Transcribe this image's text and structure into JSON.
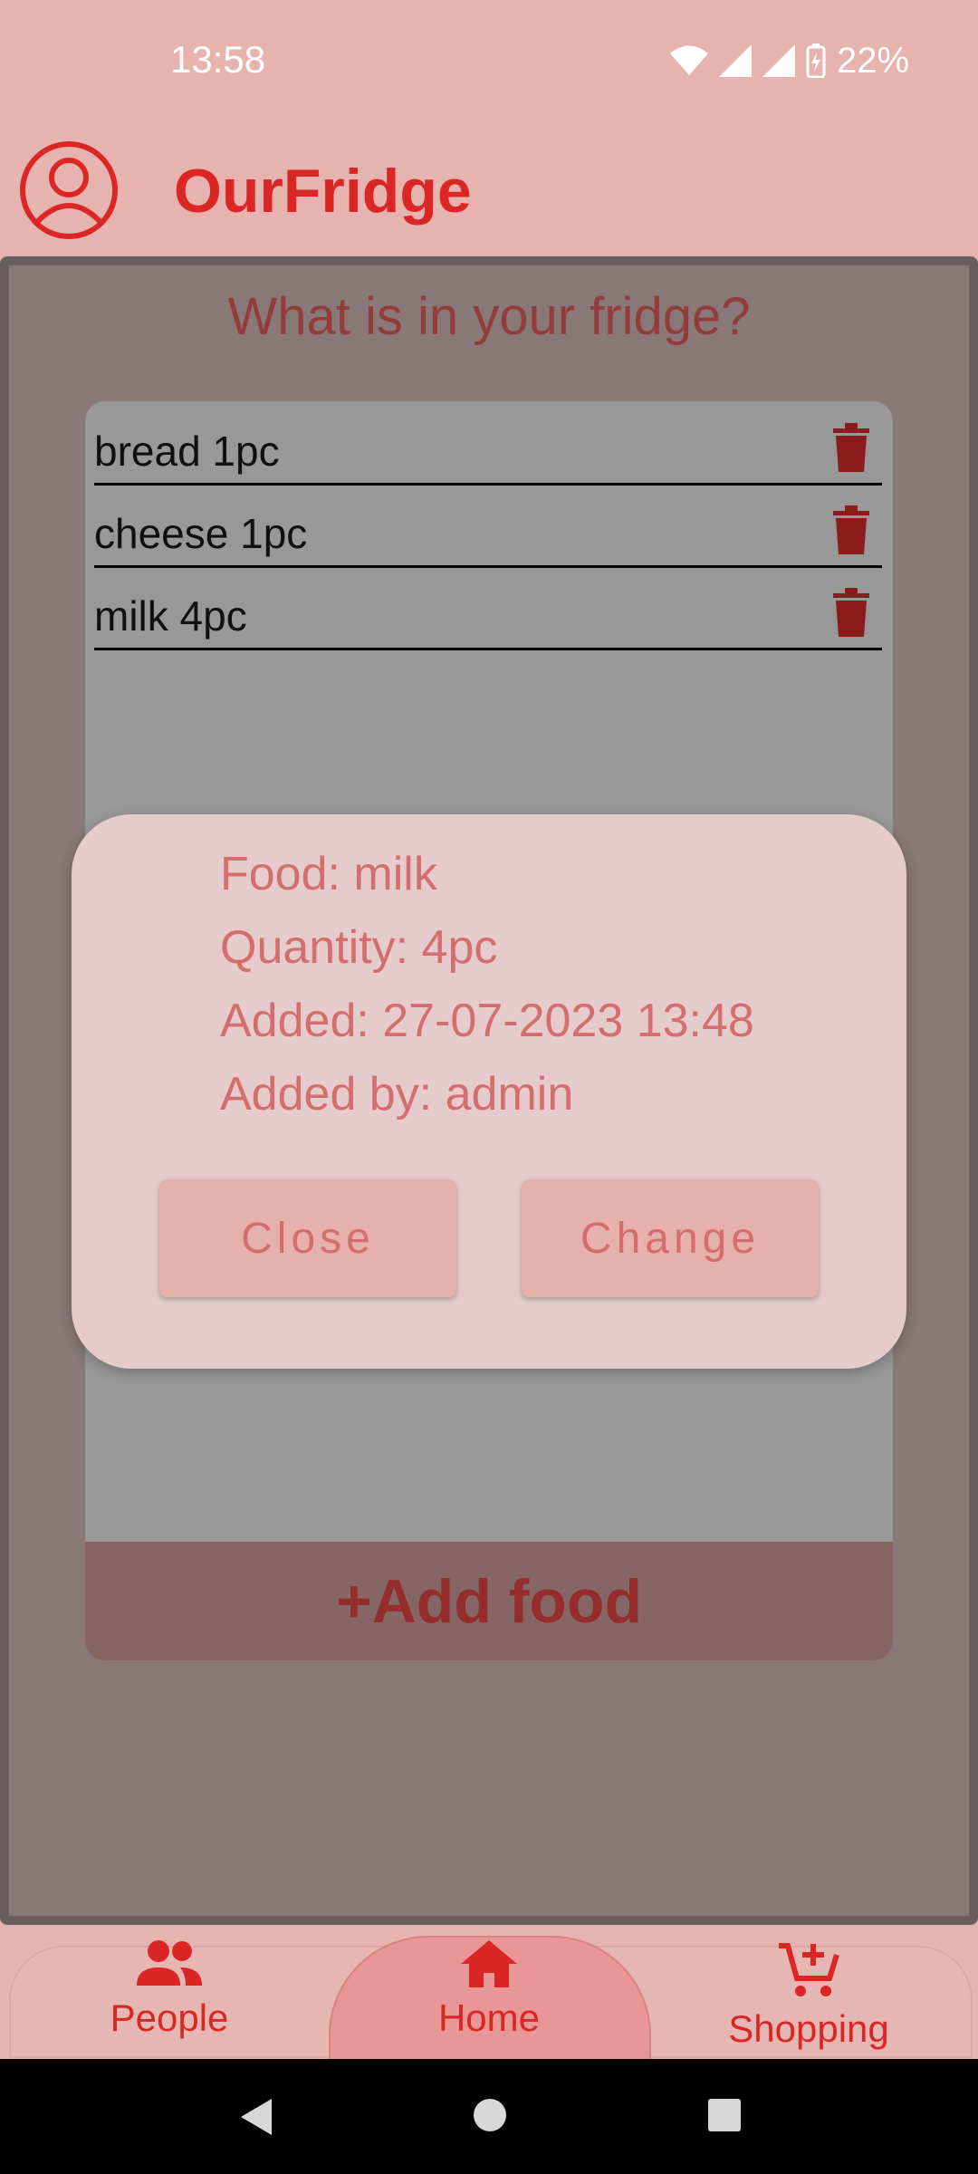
{
  "status_bar": {
    "time": "13:58",
    "battery": "22%"
  },
  "header": {
    "title": "OurFridge"
  },
  "main": {
    "heading": "What is in your fridge?",
    "items": [
      {
        "label": "bread 1pc"
      },
      {
        "label": "cheese 1pc"
      },
      {
        "label": "milk 4pc"
      }
    ],
    "add_button": "+Add food"
  },
  "dialog": {
    "food": "Food: milk",
    "quantity": "Quantity: 4pc",
    "added": "Added: 27-07-2023 13:48",
    "added_by": "Added by: admin",
    "close_label": "Close",
    "change_label": "Change"
  },
  "bottom_nav": {
    "items": [
      {
        "label": "People",
        "icon": "people-icon"
      },
      {
        "label": "Home",
        "icon": "home-icon",
        "active": true
      },
      {
        "label": "Shopping",
        "icon": "add-shopping-cart-icon"
      }
    ]
  },
  "colors": {
    "accent": "#db2626",
    "dialog_bg": "#e6cbcc",
    "dialog_text": "#d46d6d",
    "dim_overlay": "#887878"
  }
}
